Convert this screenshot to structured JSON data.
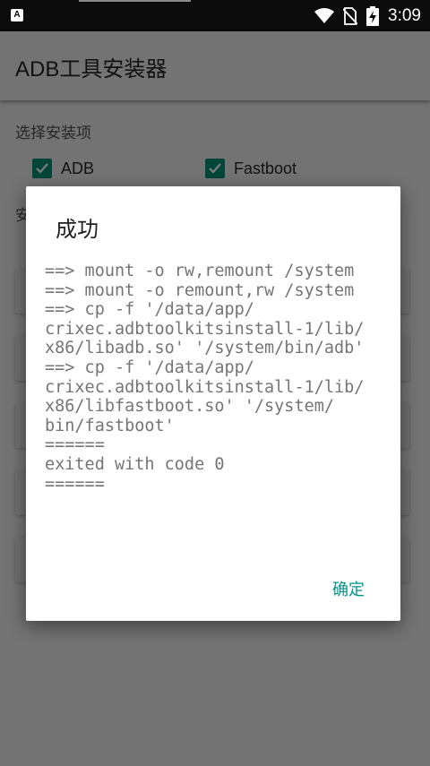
{
  "status_bar": {
    "app_icon": "A",
    "time": "3:09",
    "icons": [
      "wifi-icon",
      "no-sim-icon",
      "battery-charging-icon"
    ]
  },
  "app": {
    "title": "ADB工具安装器"
  },
  "content": {
    "section_title": "选择安装项",
    "section2_partial": "安",
    "options": [
      {
        "label": "ADB",
        "checked": true
      },
      {
        "label": "Fastboot",
        "checked": true
      }
    ]
  },
  "dialog": {
    "title": "成功",
    "message": "==> mount -o rw,remount /system\n==> mount -o remount,rw /system\n==> cp -f '/data/app/\ncrixec.adbtoolkitsinstall-1/lib/\nx86/libadb.so' '/system/bin/adb'\n==> cp -f '/data/app/\ncrixec.adbtoolkitsinstall-1/lib/\nx86/libfastboot.so' '/system/\nbin/fastboot'\n======\nexited with code 0\n======",
    "ok_label": "确定"
  },
  "colors": {
    "accent": "#009688",
    "checkbox": "#004638",
    "scrim_background": "#737373"
  }
}
